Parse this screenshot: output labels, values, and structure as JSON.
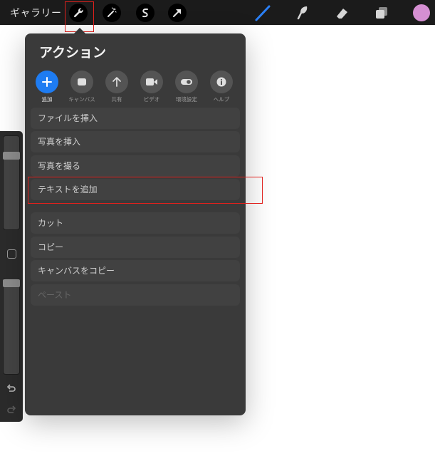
{
  "topbar": {
    "gallery_label": "ギャラリー",
    "left_tools": [
      {
        "icon": "wrench-icon",
        "label": "actions"
      },
      {
        "icon": "magic-wand-icon",
        "label": "adjustments"
      },
      {
        "icon": "selection-icon",
        "label": "selection"
      },
      {
        "icon": "transform-arrow-icon",
        "label": "transform"
      }
    ],
    "right_tools": [
      {
        "icon": "brush-icon"
      },
      {
        "icon": "smudge-icon"
      },
      {
        "icon": "eraser-icon"
      },
      {
        "icon": "layers-icon"
      },
      {
        "icon": "color-swatch-icon"
      }
    ],
    "current_color": "#d58fd2"
  },
  "actions_panel": {
    "title": "アクション",
    "tabs": [
      {
        "label": "追加",
        "icon": "plus-icon",
        "active": true
      },
      {
        "label": "キャンバス",
        "icon": "canvas-icon",
        "active": false
      },
      {
        "label": "共有",
        "icon": "share-arrow-icon",
        "active": false
      },
      {
        "label": "ビデオ",
        "icon": "video-camera-icon",
        "active": false
      },
      {
        "label": "環境設定",
        "icon": "toggle-icon",
        "active": false
      },
      {
        "label": "ヘルプ",
        "icon": "info-icon",
        "active": false
      }
    ],
    "items": [
      "ファイルを挿入",
      "写真を挿入",
      "写真を撮る",
      "テキストを追加",
      "カット",
      "コピー",
      "キャンバスをコピー",
      "ペースト"
    ]
  },
  "colors": {
    "accent": "#1e7cf2",
    "highlight": "#e0201c"
  }
}
